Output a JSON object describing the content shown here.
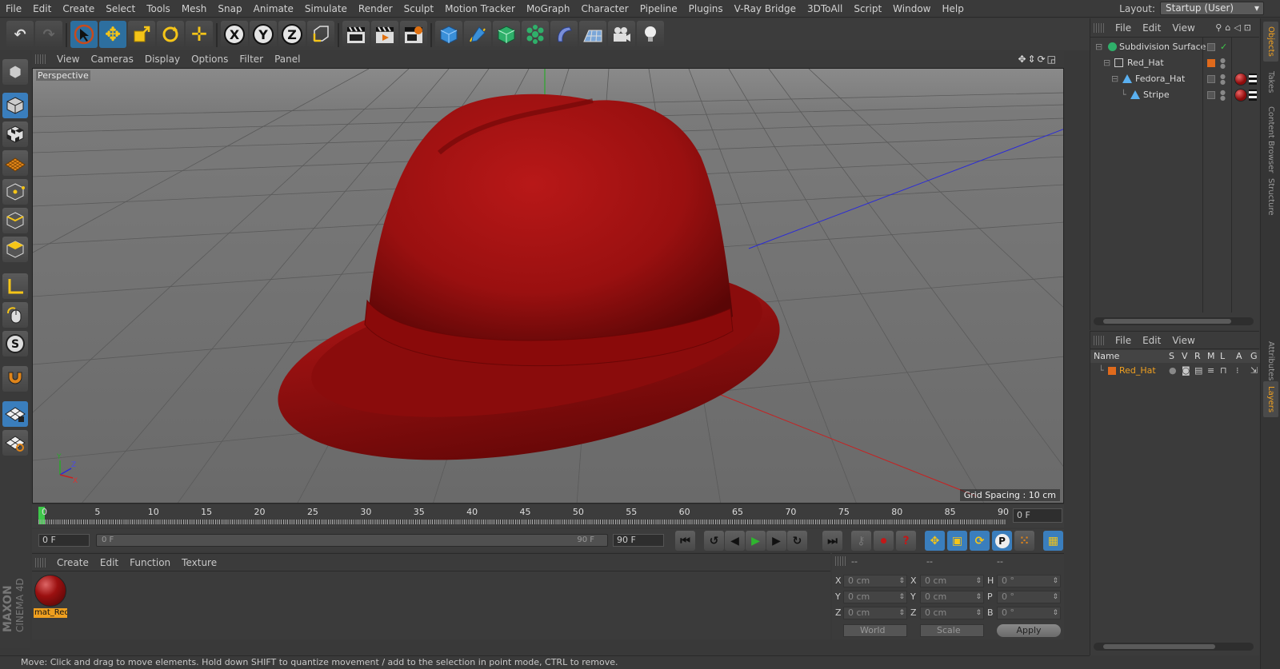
{
  "menubar": {
    "items": [
      "File",
      "Edit",
      "Create",
      "Select",
      "Tools",
      "Mesh",
      "Snap",
      "Animate",
      "Simulate",
      "Render",
      "Sculpt",
      "Motion Tracker",
      "MoGraph",
      "Character",
      "Pipeline",
      "Plugins",
      "V-Ray Bridge",
      "3DToAll",
      "Script",
      "Window",
      "Help"
    ],
    "layout_label": "Layout:",
    "layout_value": "Startup (User)"
  },
  "toolbar": {
    "axis_x": "X",
    "axis_y": "Y",
    "axis_z": "Z"
  },
  "viewport": {
    "menu": [
      "View",
      "Cameras",
      "Display",
      "Options",
      "Filter",
      "Panel"
    ],
    "label": "Perspective",
    "grid_spacing": "Grid Spacing : 10 cm",
    "axis_y": "Y",
    "axis_z": "Z",
    "axis_x": "X",
    "hat_color": "#a41414"
  },
  "timeline": {
    "ticks": [
      "0",
      "5",
      "10",
      "15",
      "20",
      "25",
      "30",
      "35",
      "40",
      "45",
      "50",
      "55",
      "60",
      "65",
      "70",
      "75",
      "80",
      "85",
      "90"
    ],
    "current_frame": "0 F"
  },
  "transport": {
    "start_field": "0 F",
    "range_start": "0 F",
    "range_end": "90 F",
    "end_field": "90 F"
  },
  "materials": {
    "menu": [
      "Create",
      "Edit",
      "Function",
      "Texture"
    ],
    "items": [
      {
        "name": "mat_Red"
      }
    ]
  },
  "coordinates": {
    "headers": [
      "--",
      "--",
      "--"
    ],
    "rows": [
      {
        "l1": "X",
        "v1": "0 cm",
        "l2": "X",
        "v2": "0 cm",
        "l3": "H",
        "v3": "0 °"
      },
      {
        "l1": "Y",
        "v1": "0 cm",
        "l2": "Y",
        "v2": "0 cm",
        "l3": "P",
        "v3": "0 °"
      },
      {
        "l1": "Z",
        "v1": "0 cm",
        "l2": "Z",
        "v2": "0 cm",
        "l3": "B",
        "v3": "0 °"
      }
    ],
    "mode_world": "World",
    "mode_scale": "Scale",
    "apply": "Apply"
  },
  "status": {
    "text": "Move: Click and drag to move elements. Hold down SHIFT to quantize movement / add to the selection in point mode, CTRL to remove."
  },
  "objects": {
    "menu": [
      "File",
      "Edit",
      "View"
    ],
    "items": [
      {
        "name": "Subdivision Surface"
      },
      {
        "name": "Red_Hat"
      },
      {
        "name": "Fedora_Hat"
      },
      {
        "name": "Stripe"
      }
    ]
  },
  "layers": {
    "menu": [
      "File",
      "Edit",
      "View"
    ],
    "header": {
      "name": "Name",
      "s": "S",
      "v": "V",
      "r": "R",
      "m": "M",
      "l": "L",
      "a": "A",
      "g": "G"
    },
    "items": [
      {
        "name": "Red_Hat"
      }
    ]
  },
  "side_tabs": [
    "Objects",
    "Takes",
    "Content Browser",
    "Structure",
    "Attributes",
    "Layers"
  ],
  "branding": {
    "line1": "MAXON",
    "line2": "CINEMA 4D"
  }
}
